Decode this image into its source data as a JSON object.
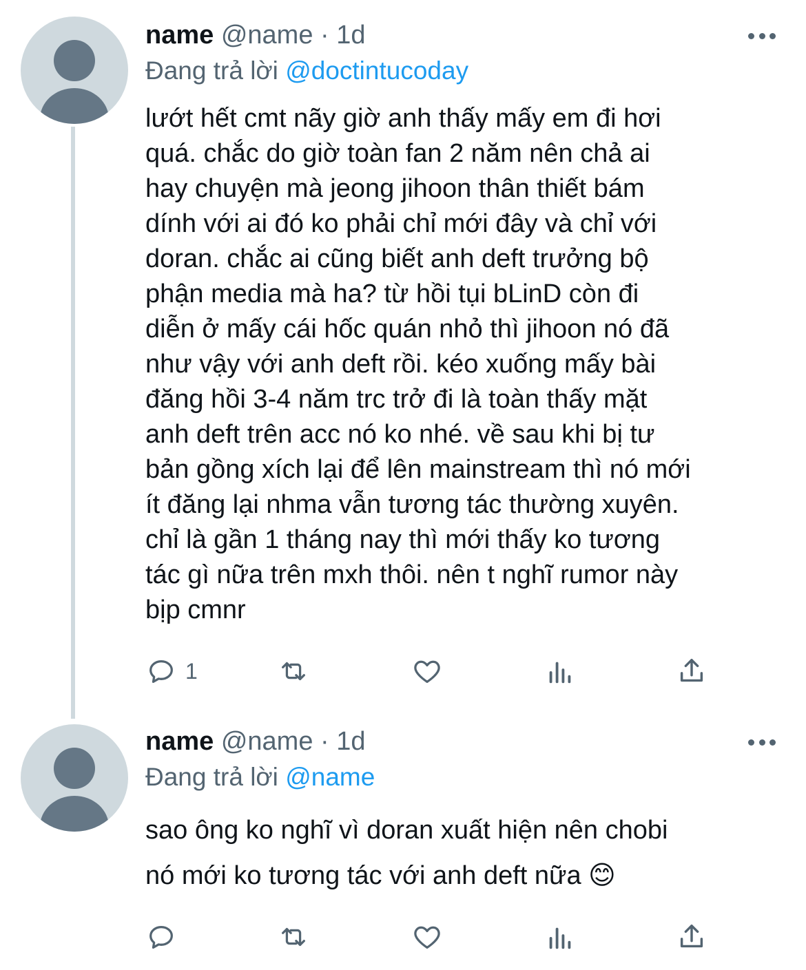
{
  "tweets": [
    {
      "display_name": "name",
      "handle": "@name",
      "dot": "·",
      "time": "1d",
      "reply_label": "Đang trả lời",
      "reply_mention": "@doctintucoday",
      "body": "lướt hết cmt nãy giờ anh thấy mấy em đi hơi\nquá. chắc do giờ toàn fan 2 năm nên chả ai\nhay chuyện mà jeong jihoon thân thiết bám\ndính với ai đó ko phải chỉ mới đây và chỉ với\ndoran. chắc ai cũng biết anh deft trưởng bộ\nphận media mà ha? từ hồi tụi bLinD còn đi\ndiễn ở mấy cái hốc quán nhỏ thì jihoon nó đã\nnhư vậy với anh deft rồi. kéo xuống mấy bài\nđăng hồi 3-4 năm trc trở đi là toàn thấy mặt\nanh deft trên acc nó ko nhé. về sau khi bị tư\nbản gồng xích lại để lên mainstream thì nó mới\nít đăng lại nhma vẫn tương tác thường xuyên.\nchỉ là gần 1 tháng nay thì mới thấy ko tương\ntác gì nữa trên mxh thôi. nên t nghĩ rumor này\nbịp cmnr",
      "reply_count": "1"
    },
    {
      "display_name": "name",
      "handle": "@name",
      "dot": "·",
      "time": "1d",
      "reply_label": "Đang trả lời",
      "reply_mention": "@name",
      "body": "sao ông ko nghĩ vì doran xuất hiện nên chobi\nnó mới ko tương tác với anh deft nữa 😊",
      "reply_count": ""
    }
  ],
  "icons": {
    "reply": "reply-icon",
    "retweet": "retweet-icon",
    "like": "heart-icon",
    "analytics": "analytics-icon",
    "share": "share-icon",
    "more": "more-icon"
  },
  "colors": {
    "text": "#0f1419",
    "secondary": "#536471",
    "link": "#1d9bf0",
    "avatar_bg": "#cfd9de",
    "avatar_fg": "#657786"
  }
}
